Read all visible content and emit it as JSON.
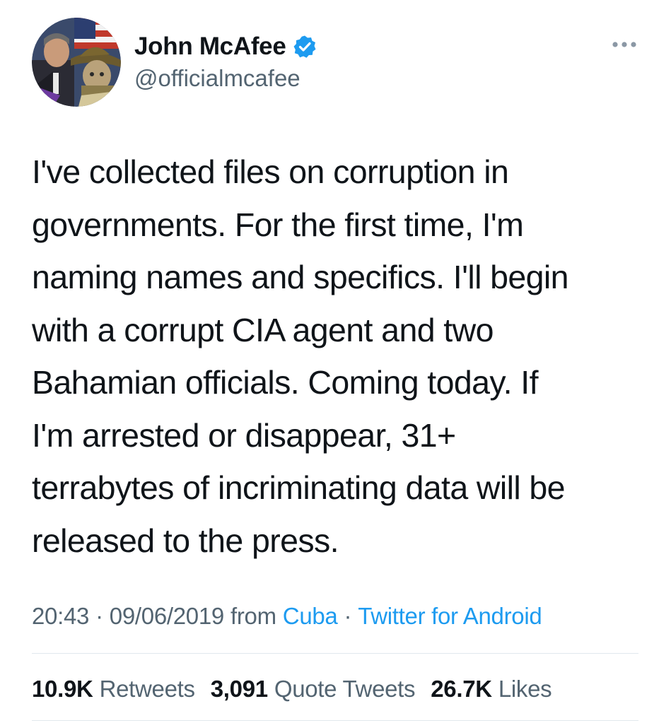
{
  "author": {
    "display_name": "John McAfee",
    "handle": "@officialmcafee",
    "verified_icon": "verified-badge-icon",
    "avatar": "profile-avatar"
  },
  "more_icon": "more-options-icon",
  "tweet": {
    "text": "I've collected files on corruption in\ngovernments. For the first time, I'm\nnaming names and specifics. I'll begin\nwith a corrupt CIA agent and two\nBahamian officials. Coming today. If\nI'm arrested or disappear, 31+\nterrabytes of incriminating data will be\nreleased to the press."
  },
  "meta": {
    "time": "20:43",
    "date": "09/06/2019",
    "from_label": "from",
    "location": "Cuba",
    "source": "Twitter for Android",
    "separator": "·"
  },
  "stats": {
    "retweets_count": "10.9K",
    "retweets_label": "Retweets",
    "quote_count": "3,091",
    "quote_label": "Quote Tweets",
    "likes_count": "26.7K",
    "likes_label": "Likes"
  },
  "colors": {
    "link": "#1d9bf0",
    "secondary_text": "#536471",
    "primary_text": "#0f1419",
    "divider": "#e1e8ed"
  }
}
